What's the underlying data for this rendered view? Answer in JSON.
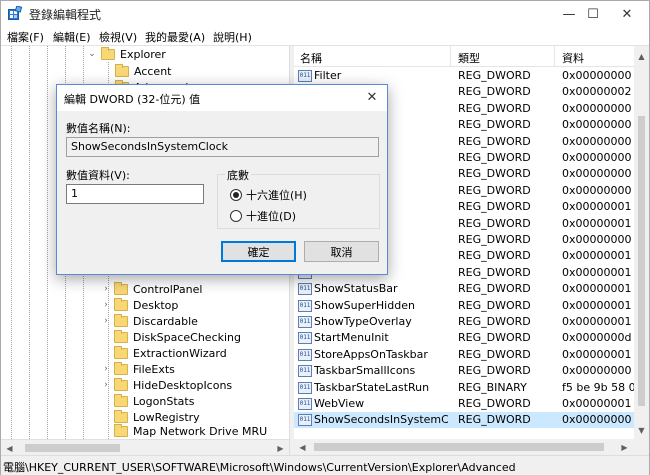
{
  "window": {
    "title": "登錄編輯程式",
    "minimize": "—",
    "maximize": "☐",
    "close": "✕"
  },
  "menu": [
    "檔案(F)",
    "編輯(E)",
    "檢視(V)",
    "我的最愛(A)",
    "說明(H)"
  ],
  "tree": {
    "items": [
      {
        "label": "Explorer",
        "expanded": true
      },
      {
        "label": "Accent"
      },
      {
        "label": "Advanced"
      },
      {
        "label": "ControlPanel"
      },
      {
        "label": "Desktop"
      },
      {
        "label": "Discardable"
      },
      {
        "label": "DiskSpaceChecking"
      },
      {
        "label": "ExtractionWizard"
      },
      {
        "label": "FileExts"
      },
      {
        "label": "HideDesktopIcons"
      },
      {
        "label": "LogonStats"
      },
      {
        "label": "LowRegistry"
      },
      {
        "label": "Map Network Drive MRU"
      }
    ]
  },
  "list": {
    "columns": [
      "名稱",
      "類型",
      "資料"
    ],
    "rows": [
      {
        "name": "Filter",
        "type": "REG_DWORD",
        "data": "0x00000000 (0"
      },
      {
        "name": "",
        "type": "REG_DWORD",
        "data": "0x00000002 (2"
      },
      {
        "name": "",
        "type": "REG_DWORD",
        "data": "0x00000000 (0"
      },
      {
        "name": "",
        "type": "REG_DWORD",
        "data": "0x00000000 (0"
      },
      {
        "name": "",
        "type": "REG_DWORD",
        "data": "0x00000000 (0"
      },
      {
        "name": "",
        "type": "REG_DWORD",
        "data": "0x00000000 (0"
      },
      {
        "name": "dToCurren…",
        "type": "REG_DWORD",
        "data": "0x00000000 (0"
      },
      {
        "name": "llFolders",
        "type": "REG_DWORD",
        "data": "0x00000000 (0"
      },
      {
        "name": "le",
        "type": "REG_DWORD",
        "data": "0x00000001 (1"
      },
      {
        "name": "s",
        "type": "REG_DWORD",
        "data": "0x00000001 (1"
      },
      {
        "name": "",
        "type": "REG_DWORD",
        "data": "0x00000000 (0"
      },
      {
        "name": "or",
        "type": "REG_DWORD",
        "data": "0x00000001 (1"
      },
      {
        "name": "",
        "type": "REG_DWORD",
        "data": "0x00000001 (1"
      },
      {
        "name": "ShowStatusBar",
        "type": "REG_DWORD",
        "data": "0x00000001 (1"
      },
      {
        "name": "ShowSuperHidden",
        "type": "REG_DWORD",
        "data": "0x00000001 (1"
      },
      {
        "name": "ShowTypeOverlay",
        "type": "REG_DWORD",
        "data": "0x00000001 (1"
      },
      {
        "name": "StartMenuInit",
        "type": "REG_DWORD",
        "data": "0x0000000d (1"
      },
      {
        "name": "StoreAppsOnTaskbar",
        "type": "REG_DWORD",
        "data": "0x00000001 (1"
      },
      {
        "name": "TaskbarSmallIcons",
        "type": "REG_DWORD",
        "data": "0x00000000 (0"
      },
      {
        "name": "TaskbarStateLastRun",
        "type": "REG_BINARY",
        "data": "f5 be 9b 58 00"
      },
      {
        "name": "WebView",
        "type": "REG_DWORD",
        "data": "0x00000001 (1"
      },
      {
        "name": "ShowSecondsInSystemClo…",
        "type": "REG_DWORD",
        "data": "0x00000000 (0",
        "selected": true
      }
    ]
  },
  "status": "電腦\\HKEY_CURRENT_USER\\SOFTWARE\\Microsoft\\Windows\\CurrentVersion\\Explorer\\Advanced",
  "dialog": {
    "title": "編輯 DWORD (32-位元) 值",
    "close": "✕",
    "value_name_label": "數值名稱(N):",
    "value_name": "ShowSecondsInSystemClock",
    "value_data_label": "數值資料(V):",
    "value_data": "1",
    "base_label": "底數",
    "hex_label": "十六進位(H)",
    "dec_label": "十進位(D)",
    "base_selected": "hex",
    "ok": "確定",
    "cancel": "取消"
  },
  "colors": {
    "selection": "#cce8ff",
    "accent": "#0078d7"
  }
}
